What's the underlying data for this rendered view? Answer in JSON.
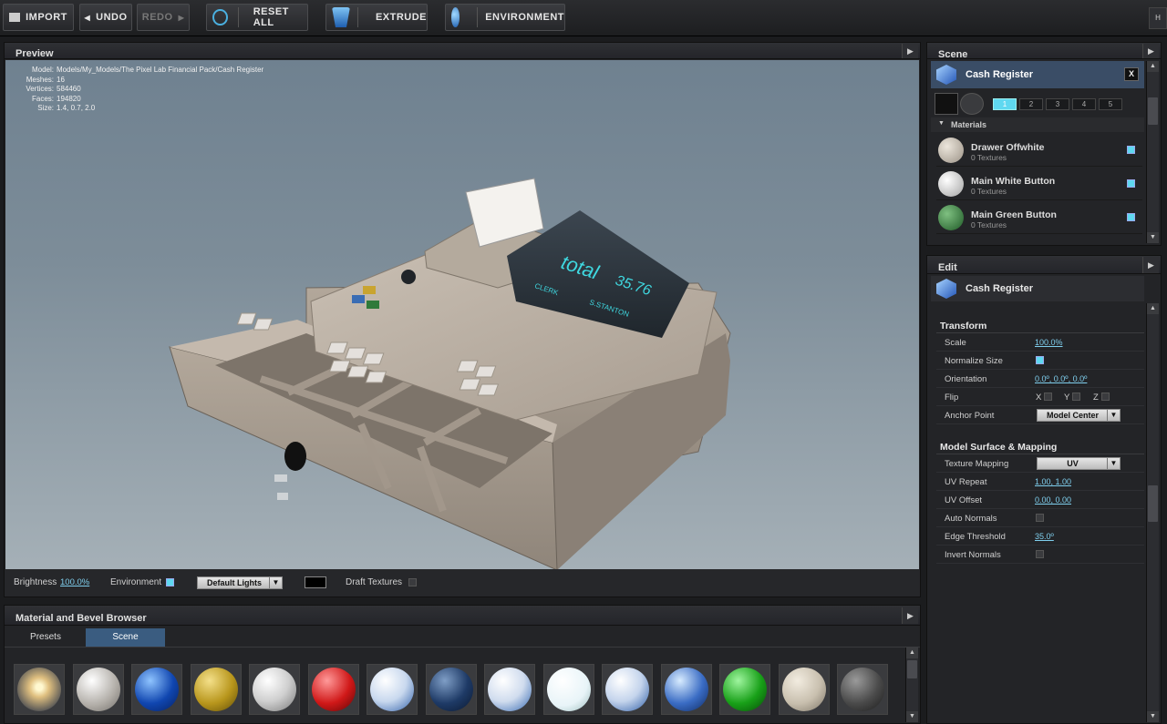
{
  "toolbar": {
    "import": "IMPORT",
    "undo": "UNDO",
    "redo": "REDO",
    "reset_all": "RESET ALL",
    "extrude": "EXTRUDE",
    "environment": "ENVIRONMENT"
  },
  "preview": {
    "title": "Preview",
    "model_info": {
      "model_label": "Model:",
      "model": "Models/My_Models/The Pixel Lab Financial Pack/Cash Register",
      "meshes_label": "Meshes:",
      "meshes": "16",
      "vertices_label": "Vertices:",
      "vertices": "584460",
      "faces_label": "Faces:",
      "faces": "194820",
      "size_label": "Size:",
      "size": "1.4, 0.7, 2.0"
    },
    "register_display": {
      "total": "total",
      "amount": "35.76",
      "clerk": "CLERK",
      "name": "S.STANTON"
    },
    "bar": {
      "brightness_label": "Brightness",
      "brightness_value": "100.0%",
      "environment_label": "Environment",
      "lights_value": "Default Lights",
      "draft_label": "Draft Textures"
    }
  },
  "browser": {
    "title": "Material and Bevel Browser",
    "tabs": [
      "Presets",
      "Scene"
    ],
    "swatch_names": [
      "glow-sphere",
      "pearl-white",
      "glossy-blue",
      "mustard-yellow",
      "white-pattern",
      "glossy-red",
      "american-flag-print",
      "navy-blue",
      "american-flag-print-2",
      "plain-white",
      "american-flag-print-3",
      "blue-logo-sphere",
      "glossy-green",
      "beige-fabric",
      "dark-gray"
    ]
  },
  "scene": {
    "title": "Scene",
    "object_name": "Cash Register",
    "close": "X",
    "number_tabs": [
      "1",
      "2",
      "3",
      "4",
      "5"
    ],
    "materials_label": "Materials",
    "materials": [
      {
        "name": "Drawer Offwhite",
        "textures": "0 Textures"
      },
      {
        "name": "Main White Button",
        "textures": "0 Textures"
      },
      {
        "name": "Main Green Button",
        "textures": "0 Textures"
      }
    ]
  },
  "edit": {
    "title": "Edit",
    "object_name": "Cash Register",
    "transform_label": "Transform",
    "scale_label": "Scale",
    "scale_value": "100.0%",
    "normalize_label": "Normalize Size",
    "orientation_label": "Orientation",
    "orientation_value": "0.0º, 0.0º, 0.0º",
    "flip_label": "Flip",
    "flip_x": "X",
    "flip_y": "Y",
    "flip_z": "Z",
    "anchor_label": "Anchor Point",
    "anchor_value": "Model Center",
    "surface_label": "Model Surface & Mapping",
    "texmap_label": "Texture Mapping",
    "texmap_value": "UV",
    "uvrepeat_label": "UV Repeat",
    "uvrepeat_value": "1.00, 1.00",
    "uvoffset_label": "UV Offset",
    "uvoffset_value": "0.00, 0.00",
    "autonormals_label": "Auto Normals",
    "edge_label": "Edge Threshold",
    "edge_value": "35.0º",
    "invert_label": "Invert Normals"
  },
  "colors": {
    "accent": "#5fd8f0",
    "selection": "#3a5c80",
    "display_text": "#3fd8e0"
  }
}
